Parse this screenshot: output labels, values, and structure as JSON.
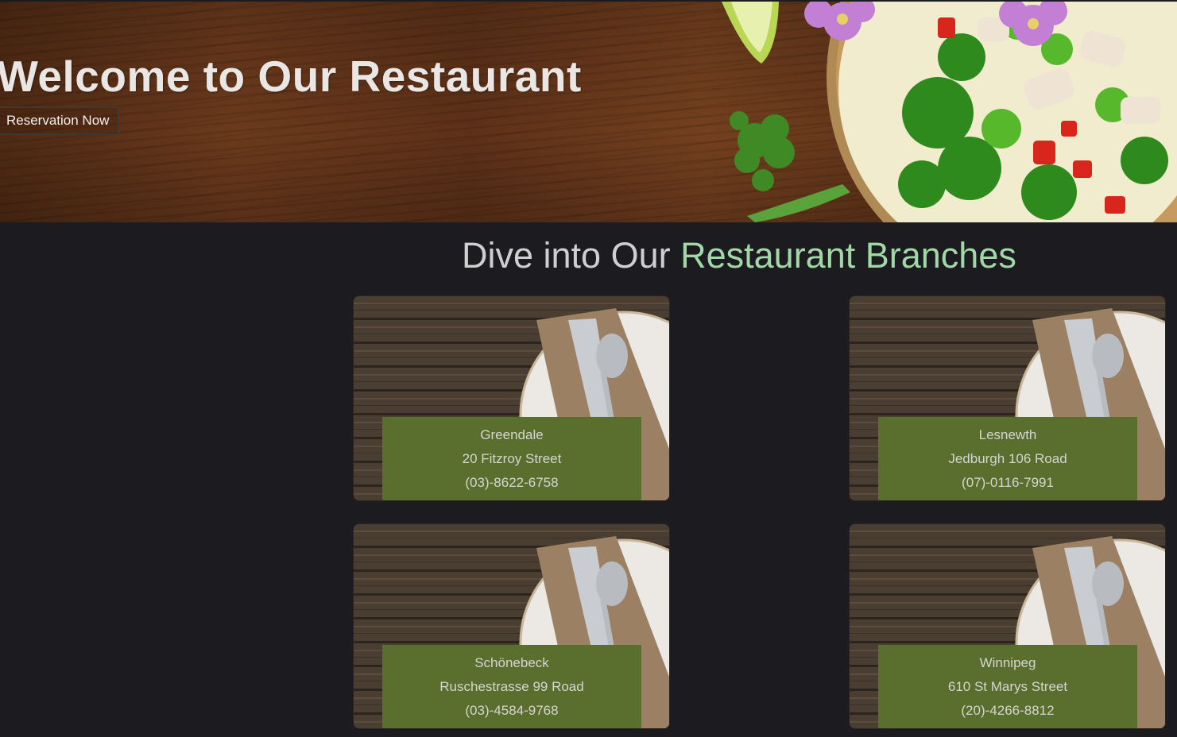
{
  "hero": {
    "title": "Welcome to Our Restaurant",
    "button_label": "Reservation Now"
  },
  "branches_section": {
    "title_part1": "Dive into Our ",
    "title_part2": "Restaurant Branches",
    "accent_color": "#a2d8a8"
  },
  "branches": [
    {
      "city": "Greendale",
      "address": "20 Fitzroy Street",
      "phone": "(03)-8622-6758"
    },
    {
      "city": "Lesnewth",
      "address": "Jedburgh 106 Road",
      "phone": "(07)-0116-7991"
    },
    {
      "city": "Schönebeck",
      "address": "Ruschestrasse 99 Road",
      "phone": "(03)-4584-9768"
    },
    {
      "city": "Winnipeg",
      "address": "610 St Marys Street",
      "phone": "(20)-4266-8812"
    }
  ],
  "colors": {
    "page_background": "#1c1b20",
    "card_info_background": "#5a6e2e"
  }
}
